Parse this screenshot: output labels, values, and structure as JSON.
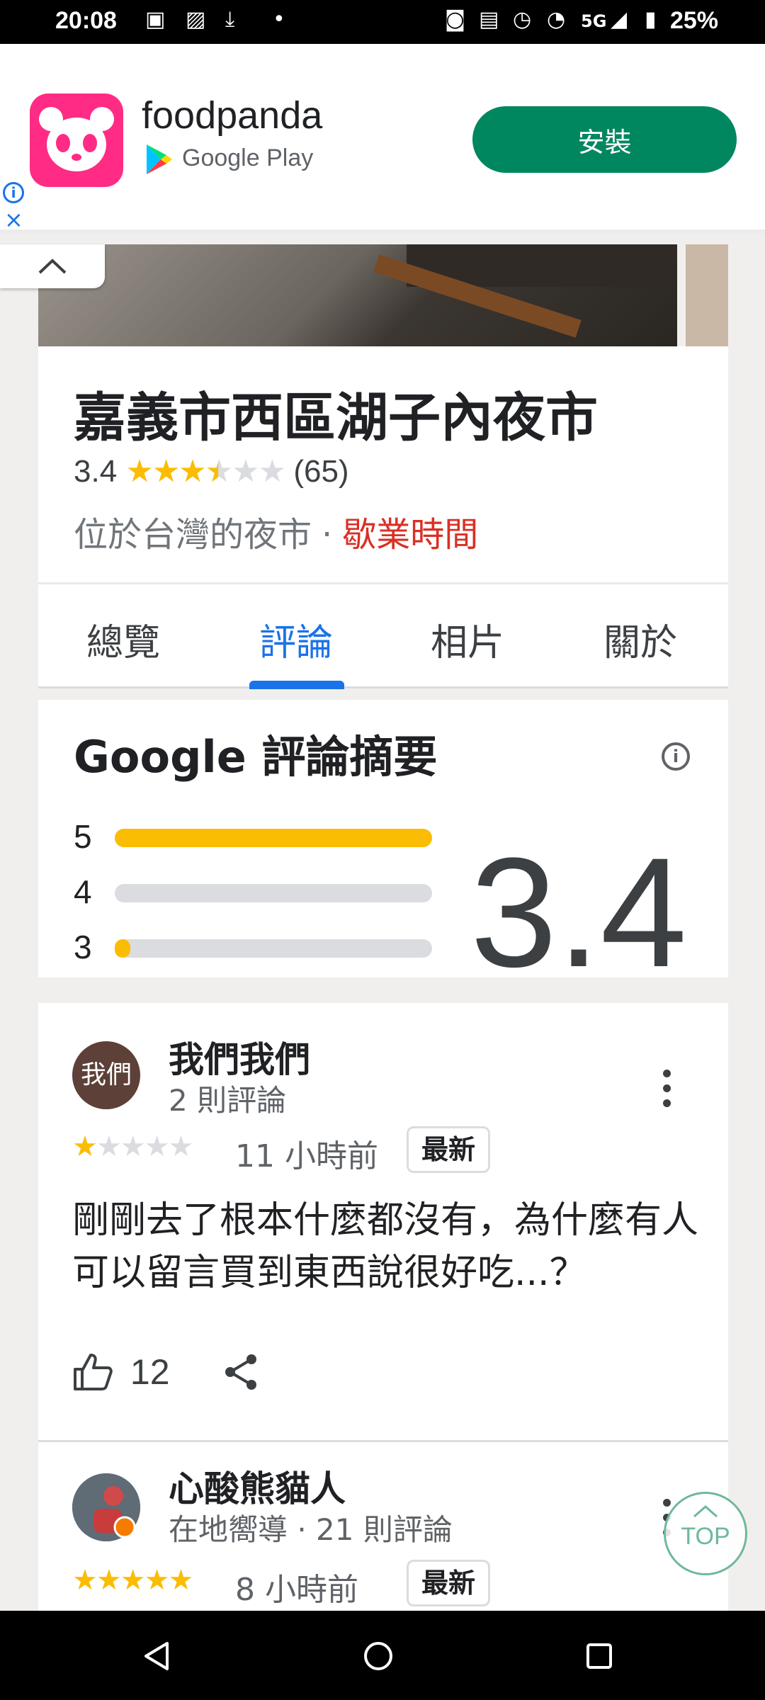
{
  "status_bar": {
    "time": "20:08",
    "network": "5G",
    "battery": "25%"
  },
  "ad": {
    "app_name": "foodpanda",
    "store": "Google Play",
    "install_label": "安裝",
    "info": "i",
    "close": "×"
  },
  "place": {
    "title": "嘉義市西區湖子內夜市",
    "rating": "3.4",
    "review_count": "(65)",
    "stars": 3.4,
    "category": "位於台灣的夜市",
    "dot": "·",
    "hours": "歇業時間"
  },
  "tabs": [
    {
      "label": "總覽",
      "active": false
    },
    {
      "label": "評論",
      "active": true
    },
    {
      "label": "相片",
      "active": false
    },
    {
      "label": "關於",
      "active": false
    }
  ],
  "summary": {
    "title": "Google 評論摘要",
    "score": "3.4",
    "distribution": [
      {
        "label": "5",
        "fraction": 1.0
      },
      {
        "label": "4",
        "fraction": 0.0
      },
      {
        "label": "3",
        "fraction": 0.05
      }
    ]
  },
  "reviews": [
    {
      "avatar_text": "我們",
      "avatar_color": "#5d4037",
      "name": "我們我們",
      "meta": "2 則評論",
      "stars": 1,
      "time": "11 小時前",
      "badge": "最新",
      "text": "剛剛去了根本什麼都沒有，為什麼有人可以留言買到東西說很好吃...？",
      "likes": "12"
    },
    {
      "avatar_text": "",
      "avatar_color": "#4a5a6a",
      "name": "心酸熊貓人",
      "meta": "在地嚮導 · 21 則評論",
      "stars": 5,
      "time": "8 小時前",
      "badge": "最新"
    }
  ],
  "top_button": "TOP",
  "colors": {
    "accent": "#1a73e8",
    "star": "#fbbc04",
    "install": "#01875f",
    "hours": "#d93025"
  }
}
